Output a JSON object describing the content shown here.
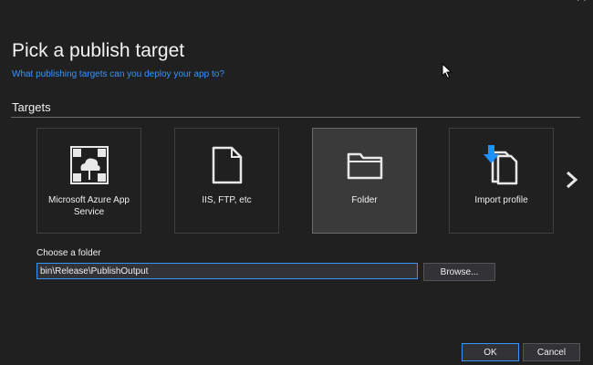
{
  "dialog": {
    "title": "Pick a publish target",
    "subtitle": "What publishing targets can you deploy your app to?",
    "section_label": "Targets"
  },
  "targets": [
    {
      "label": "Microsoft Azure App Service",
      "icon": "azure-app-service-icon",
      "selected": false
    },
    {
      "label": "IIS, FTP, etc",
      "icon": "document-icon",
      "selected": false
    },
    {
      "label": "Folder",
      "icon": "folder-icon",
      "selected": true
    },
    {
      "label": "Import profile",
      "icon": "import-profile-icon",
      "selected": false
    }
  ],
  "folder": {
    "label": "Choose a folder",
    "value": "bin\\Release\\PublishOutput",
    "browse_label": "Browse..."
  },
  "buttons": {
    "ok_label": "OK",
    "cancel_label": "Cancel"
  },
  "colors": {
    "background": "#202020",
    "accent": "#3794ff",
    "selected_tile": "#3a3a3a"
  }
}
